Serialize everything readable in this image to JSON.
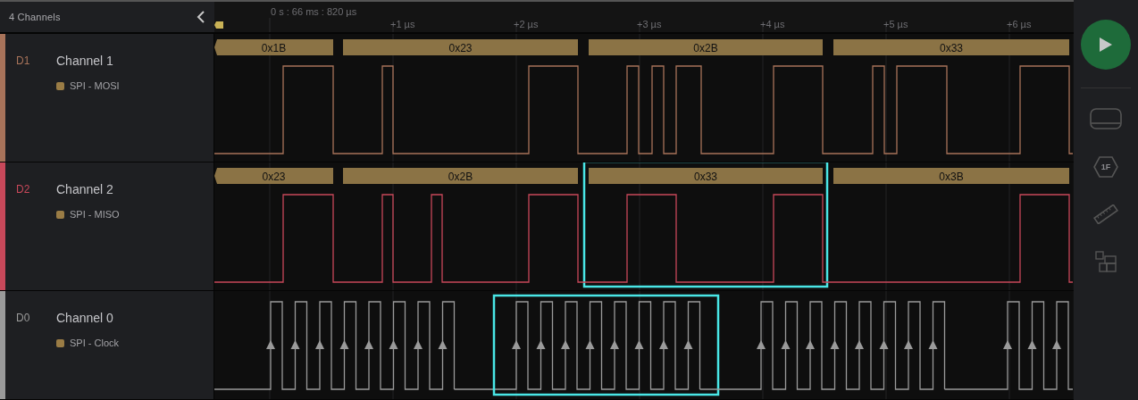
{
  "sidebar": {
    "title": "4 Channels"
  },
  "timeline": {
    "cursor_time": "0 s : 66 ms : 820 µs",
    "ticks": [
      "+1 µs",
      "+2 µs",
      "+3 µs",
      "+4 µs",
      "+5 µs",
      "+6 µs"
    ]
  },
  "channels": [
    {
      "id_label": "D1",
      "name": "Channel 1",
      "analyzer": "SPI - MOSI",
      "color": "#a8735a",
      "kind": "data",
      "frames": [
        {
          "value": "0x1B",
          "selected": false
        },
        {
          "value": "0x23",
          "selected": false
        },
        {
          "value": "0x2B",
          "selected": false
        },
        {
          "value": "0x33",
          "selected": false
        }
      ]
    },
    {
      "id_label": "D2",
      "name": "Channel 2",
      "analyzer": "SPI - MISO",
      "color": "#c8485a",
      "kind": "data",
      "frames": [
        {
          "value": "0x23",
          "selected": false
        },
        {
          "value": "0x2B",
          "selected": false
        },
        {
          "value": "0x33",
          "selected": true
        },
        {
          "value": "0x3B",
          "selected": false
        }
      ]
    },
    {
      "id_label": "D0",
      "name": "Channel 0",
      "analyzer": "SPI - Clock",
      "color": "#9a9a9a",
      "kind": "clock",
      "bursts": [
        {
          "selected": false
        },
        {
          "selected": true
        },
        {
          "selected": false
        },
        {
          "selected": false
        }
      ]
    }
  ],
  "toolbar": {
    "frame_button_label": "1F"
  }
}
